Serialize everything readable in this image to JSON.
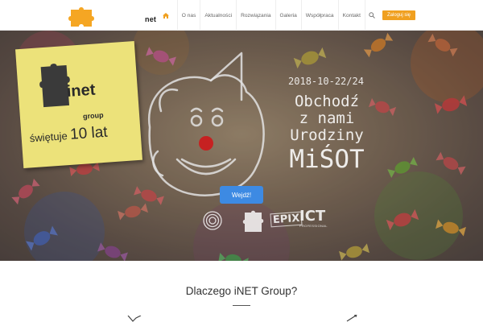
{
  "header": {
    "logo_text": "net",
    "nav": [
      {
        "label": "O nas"
      },
      {
        "label": "Aktualności"
      },
      {
        "label": "Rozwiązania"
      },
      {
        "label": "Galeria"
      },
      {
        "label": "Współpraca"
      },
      {
        "label": "Kontakt"
      }
    ],
    "login_label": "Zaloguj się",
    "icons": {
      "home": "home-icon",
      "search": "search-icon"
    },
    "accent_color": "#f0a020"
  },
  "hero": {
    "note": {
      "brand": "inet",
      "group": "group",
      "celebrates": "świętuje",
      "years": "10 lat"
    },
    "date": "2018-10-22/24",
    "headline": {
      "line1": "Obchodź",
      "line2": "z nami",
      "line3": "Urodziny",
      "big": "MiŚOT"
    },
    "enter_label": "Wejdź!",
    "enter_color": "#3d8ae3",
    "partners": {
      "epix": "EPIX",
      "ict": "ICT",
      "ict_sub": "PROFESSIONAL"
    }
  },
  "section": {
    "title": "Dlaczego iNET Group?"
  }
}
